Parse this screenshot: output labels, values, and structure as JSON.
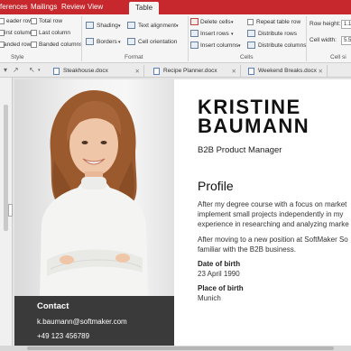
{
  "ribbon_tabs": [
    "ferences",
    "Mailings",
    "Review",
    "View",
    "Table"
  ],
  "active_tab": "Table",
  "style_group": {
    "label": "Style",
    "options": [
      {
        "label": "eader row",
        "checked": false
      },
      {
        "label": "Total row",
        "checked": false
      },
      {
        "label": "irst column",
        "checked": false
      },
      {
        "label": "Last column",
        "checked": false
      },
      {
        "label": "anded rows",
        "checked": false
      },
      {
        "label": "Banded columns",
        "checked": false
      }
    ]
  },
  "format_group": {
    "label": "Format",
    "shading": "Shading",
    "borders": "Borders",
    "text_alignment": "Text alignment",
    "cell_orientation": "Cell orientation"
  },
  "cells_group": {
    "label": "Cells",
    "delete_cells": "Delete cells",
    "insert_rows": "Insert rows",
    "insert_columns": "Insert columns",
    "repeat_table_row": "Repeat table row",
    "distribute_rows": "Distribute rows",
    "distribute_columns": "Distribute columns"
  },
  "size_group": {
    "label": "Cell si",
    "row_height_label": "Row height:",
    "row_height_value": "1.1",
    "cell_width_label": "Cell width:",
    "cell_width_value": "5.5"
  },
  "documents": [
    "Steakhouse.docx",
    "Recipe Planner.docx",
    "Weekend Breaks.docx"
  ],
  "resume": {
    "name_line1": "KRISTINE",
    "name_line2": "BAUMANN",
    "role": "B2B Product Manager",
    "profile_heading": "Profile",
    "profile_lines": [
      "After my degree course with a focus on market",
      "implement small projects independently in my",
      "experience in researching and analyzing marke"
    ],
    "profile_lines2": [
      "After moving to a new position at SoftMaker So",
      "familiar with the B2B business."
    ],
    "dob_label": "Date of birth",
    "dob_value": "23 April 1990",
    "pob_label": "Place of birth",
    "pob_value": "Munich",
    "contact_heading": "Contact",
    "email": "k.baumann@softmaker.com",
    "phone": "+49 123 456789"
  }
}
